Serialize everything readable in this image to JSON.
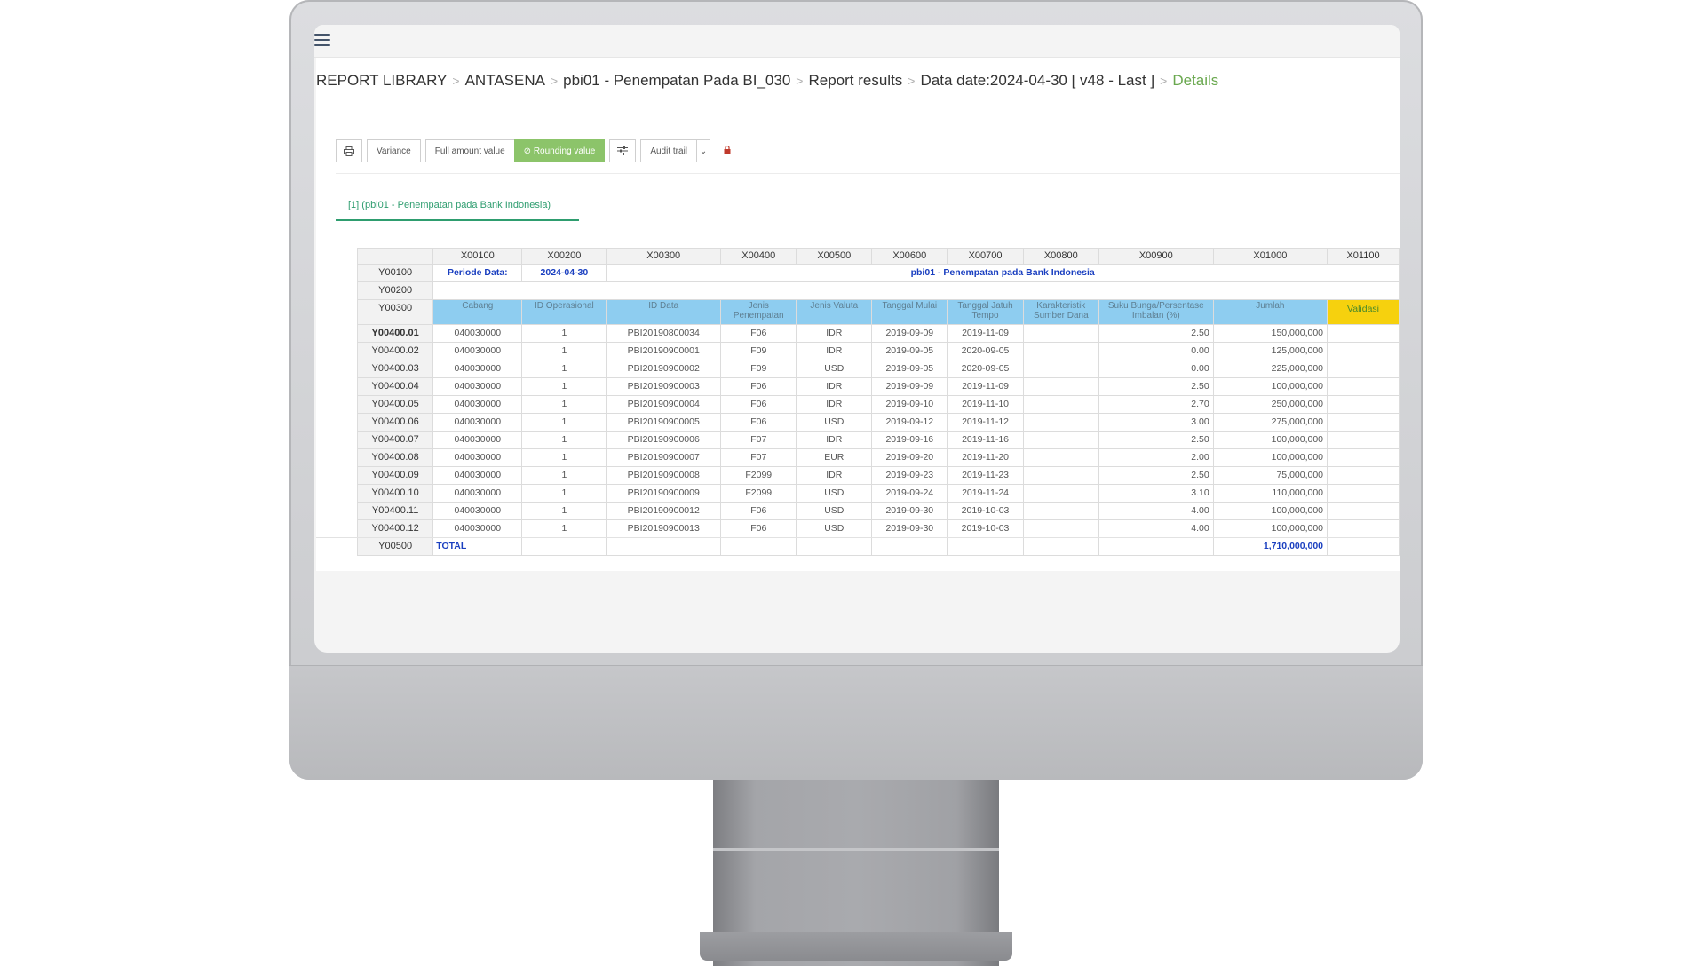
{
  "breadcrumb": {
    "items": [
      "REPORT LIBRARY",
      "ANTASENA",
      "pbi01 - Penempatan Pada BI_030",
      "Report results",
      "Data date:2024-04-30 [ v48 - Last ]"
    ],
    "active": "Details",
    "separator": ">"
  },
  "toolbar": {
    "variance": "Variance",
    "full_amount": "Full amount value",
    "rounding": "⊘ Rounding value",
    "audit_trail": "Audit trail",
    "dropdown": "⌄"
  },
  "tab": {
    "label": "[1] (pbi01 - Penempatan pada Bank Indonesia)"
  },
  "table": {
    "columns": [
      "X00100",
      "X00200",
      "X00300",
      "X00400",
      "X00500",
      "X00600",
      "X00700",
      "X00800",
      "X00900",
      "X01000",
      "X01100"
    ],
    "meta_row": {
      "id": "Y00100",
      "label": "Periode Data:",
      "date": "2024-04-30",
      "title": "pbi01 - Penempatan pada Bank Indonesia"
    },
    "blank_row": {
      "id": "Y00200"
    },
    "header_row": {
      "id": "Y00300",
      "labels": [
        "Cabang",
        "ID Operasional",
        "ID Data",
        "Jenis Penempatan",
        "Jenis Valuta",
        "Tanggal Mulai",
        "Tanggal Jatuh Tempo",
        "Karakteristik Sumber Dana",
        "Suku Bunga/Persentase Imbalan (%)",
        "Jumlah",
        "Validasi"
      ]
    },
    "rows": [
      {
        "id": "Y00400.01",
        "cells": [
          "040030000",
          "1",
          "PBI20190800034",
          "F06",
          "IDR",
          "2019-09-09",
          "2019-11-09",
          "",
          "2.50",
          "150,000,000",
          ""
        ]
      },
      {
        "id": "Y00400.02",
        "cells": [
          "040030000",
          "1",
          "PBI20190900001",
          "F09",
          "IDR",
          "2019-09-05",
          "2020-09-05",
          "",
          "0.00",
          "125,000,000",
          ""
        ]
      },
      {
        "id": "Y00400.03",
        "cells": [
          "040030000",
          "1",
          "PBI20190900002",
          "F09",
          "USD",
          "2019-09-05",
          "2020-09-05",
          "",
          "0.00",
          "225,000,000",
          ""
        ]
      },
      {
        "id": "Y00400.04",
        "cells": [
          "040030000",
          "1",
          "PBI20190900003",
          "F06",
          "IDR",
          "2019-09-09",
          "2019-11-09",
          "",
          "2.50",
          "100,000,000",
          ""
        ]
      },
      {
        "id": "Y00400.05",
        "cells": [
          "040030000",
          "1",
          "PBI20190900004",
          "F06",
          "IDR",
          "2019-09-10",
          "2019-11-10",
          "",
          "2.70",
          "250,000,000",
          ""
        ]
      },
      {
        "id": "Y00400.06",
        "cells": [
          "040030000",
          "1",
          "PBI20190900005",
          "F06",
          "USD",
          "2019-09-12",
          "2019-11-12",
          "",
          "3.00",
          "275,000,000",
          ""
        ]
      },
      {
        "id": "Y00400.07",
        "cells": [
          "040030000",
          "1",
          "PBI20190900006",
          "F07",
          "IDR",
          "2019-09-16",
          "2019-11-16",
          "",
          "2.50",
          "100,000,000",
          ""
        ]
      },
      {
        "id": "Y00400.08",
        "cells": [
          "040030000",
          "1",
          "PBI20190900007",
          "F07",
          "EUR",
          "2019-09-20",
          "2019-11-20",
          "",
          "2.00",
          "100,000,000",
          ""
        ]
      },
      {
        "id": "Y00400.09",
        "cells": [
          "040030000",
          "1",
          "PBI20190900008",
          "F2099",
          "IDR",
          "2019-09-23",
          "2019-11-23",
          "",
          "2.50",
          "75,000,000",
          ""
        ]
      },
      {
        "id": "Y00400.10",
        "cells": [
          "040030000",
          "1",
          "PBI20190900009",
          "F2099",
          "USD",
          "2019-09-24",
          "2019-11-24",
          "",
          "3.10",
          "110,000,000",
          ""
        ]
      },
      {
        "id": "Y00400.11",
        "cells": [
          "040030000",
          "1",
          "PBI20190900012",
          "F06",
          "USD",
          "2019-09-30",
          "2019-10-03",
          "",
          "4.00",
          "100,000,000",
          ""
        ]
      },
      {
        "id": "Y00400.12",
        "cells": [
          "040030000",
          "1",
          "PBI20190900013",
          "F06",
          "USD",
          "2019-09-30",
          "2019-10-03",
          "",
          "4.00",
          "100,000,000",
          ""
        ]
      }
    ],
    "total_row": {
      "id": "Y00500",
      "label": "TOTAL",
      "value": "1,710,000,000"
    }
  },
  "colors": {
    "accent_green": "#8cc46a",
    "tab_green": "#2e9d6f",
    "header_blue": "#8ecdf0",
    "validation_yellow": "#f6d10e",
    "value_blue": "#1a3fc0"
  }
}
